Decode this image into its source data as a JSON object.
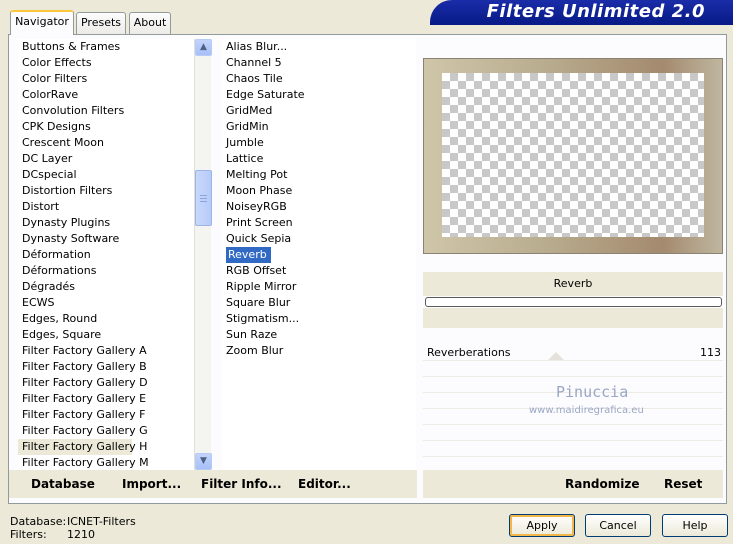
{
  "window": {
    "title": "Filters Unlimited 2.0"
  },
  "tabs": [
    {
      "label": "Navigator",
      "active": true
    },
    {
      "label": "Presets",
      "active": false
    },
    {
      "label": "About",
      "active": false
    }
  ],
  "categories": {
    "items": [
      "Buttons & Frames",
      "Color Effects",
      "Color Filters",
      "ColorRave",
      "Convolution Filters",
      "CPK Designs",
      "Crescent Moon",
      "DC Layer",
      "DCspecial",
      "Distortion Filters",
      "Distort",
      "Dynasty Plugins",
      "Dynasty Software",
      "Déformation",
      "Déformations",
      "Dégradés",
      "ECWS",
      "Edges, Round",
      "Edges, Square",
      "Filter Factory Gallery A",
      "Filter Factory Gallery B",
      "Filter Factory Gallery D",
      "Filter Factory Gallery E",
      "Filter Factory Gallery F",
      "Filter Factory Gallery G",
      "Filter Factory Gallery H",
      "Filter Factory Gallery M"
    ],
    "highlighted": "Filter Factory Gallery H"
  },
  "filters": {
    "items": [
      "Alias Blur...",
      "Channel 5",
      "Chaos Tile",
      "Edge Saturate",
      "GridMed",
      "GridMin",
      "Jumble",
      "Lattice",
      "Melting Pot",
      "Moon Phase",
      "NoiseyRGB",
      "Print Screen",
      "Quick Sepia",
      "Reverb",
      "RGB Offset",
      "Ripple Mirror",
      "Square Blur",
      "Stigmatism...",
      "Sun Raze",
      "Zoom Blur"
    ],
    "selected": "Reverb"
  },
  "preview": {
    "filter_name": "Reverb"
  },
  "parameters": [
    {
      "label": "Reverberations",
      "value": "113"
    }
  ],
  "watermark": {
    "name": "Pinuccia",
    "site": "www.maidiregrafica.eu"
  },
  "commands": {
    "database": "Database",
    "import": "Import...",
    "filter_info": "Filter Info...",
    "editor": "Editor...",
    "randomize": "Randomize",
    "reset": "Reset"
  },
  "footer": {
    "database_label": "Database:",
    "database_value": "ICNET-Filters",
    "filters_label": "Filters:",
    "filters_value": "1210"
  },
  "buttons": {
    "apply": "Apply",
    "cancel": "Cancel",
    "help": "Help"
  }
}
